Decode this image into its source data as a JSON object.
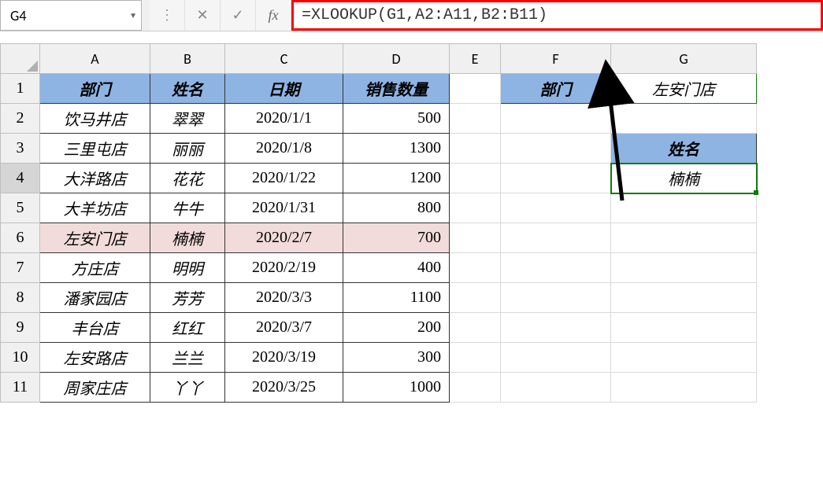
{
  "name_box": "G4",
  "formula": "=XLOOKUP(G1,A2:A11,B2:B11)",
  "columns": [
    "A",
    "B",
    "C",
    "D",
    "E",
    "F",
    "G"
  ],
  "rows": [
    "1",
    "2",
    "3",
    "4",
    "5",
    "6",
    "7",
    "8",
    "9",
    "10",
    "11"
  ],
  "headers": {
    "dept": "部门",
    "name": "姓名",
    "date": "日期",
    "qty": "销售数量"
  },
  "side": {
    "dept_label": "部门",
    "dept_value": "左安门店",
    "name_label": "姓名",
    "name_value": "楠楠"
  },
  "table": [
    {
      "dept": "饮马井店",
      "name": "翠翠",
      "date": "2020/1/1",
      "qty": "500"
    },
    {
      "dept": "三里屯店",
      "name": "丽丽",
      "date": "2020/1/8",
      "qty": "1300"
    },
    {
      "dept": "大洋路店",
      "name": "花花",
      "date": "2020/1/22",
      "qty": "1200"
    },
    {
      "dept": "大羊坊店",
      "name": "牛牛",
      "date": "2020/1/31",
      "qty": "800"
    },
    {
      "dept": "左安门店",
      "name": "楠楠",
      "date": "2020/2/7",
      "qty": "700"
    },
    {
      "dept": "方庄店",
      "name": "明明",
      "date": "2020/2/19",
      "qty": "400"
    },
    {
      "dept": "潘家园店",
      "name": "芳芳",
      "date": "2020/3/3",
      "qty": "1100"
    },
    {
      "dept": "丰台店",
      "name": "红红",
      "date": "2020/3/7",
      "qty": "200"
    },
    {
      "dept": "左安路店",
      "name": "兰兰",
      "date": "2020/3/19",
      "qty": "300"
    },
    {
      "dept": "周家庄店",
      "name": "丫丫",
      "date": "2020/3/25",
      "qty": "1000"
    }
  ]
}
